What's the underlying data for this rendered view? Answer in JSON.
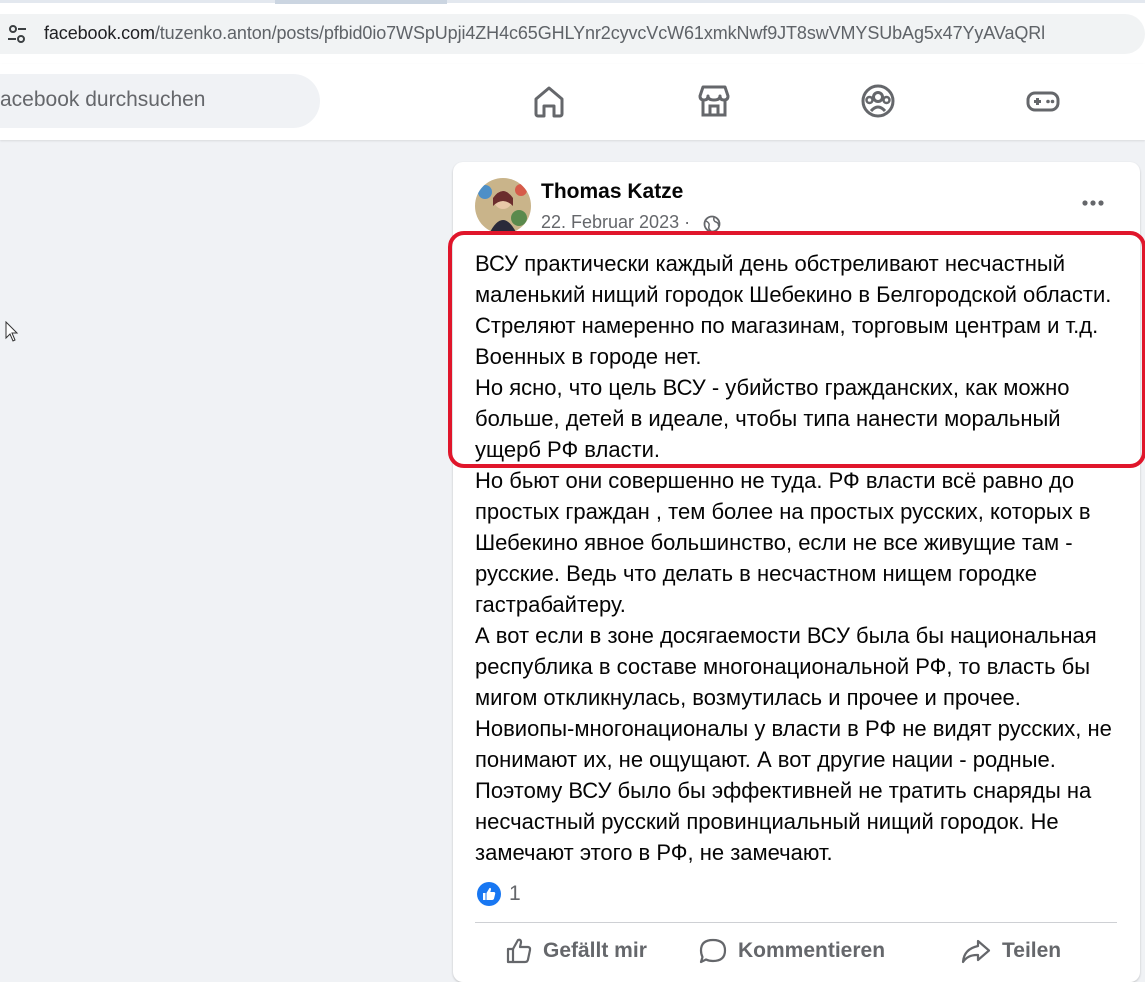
{
  "browser": {
    "url_host": "facebook.com",
    "url_path": "/tuzenko.anton/posts/pfbid0io7WSpUpji4ZH4c65GHLYnr2cyvcVcW61xmkNwf9JT8swVMYSUbAg5x47YyAVaQRl",
    "site_info_icon": "tune-icon"
  },
  "nav": {
    "search_placeholder": "acebook durchsuchen",
    "icons": [
      "home-icon",
      "marketplace-icon",
      "groups-icon",
      "gaming-icon"
    ]
  },
  "post": {
    "author": "Thomas Katze",
    "date": "22. Februar 2023 ·",
    "audience_icon": "globe-icon",
    "paragraphs_highlighted": [
      "ВСУ практически каждый день обстреливают несчастный маленький нищий городок Шебекино в Белгородской области. Стреляют намеренно по магазинам, торговым центрам и т.д. Военных в городе нет.",
      "Но ясно, что цель ВСУ - убийство гражданских, как можно больше, детей в идеале, чтобы типа нанести моральный ущерб РФ власти."
    ],
    "paragraphs_rest": [
      "Но бьют они совершенно не туда. РФ власти всё равно до простых граждан , тем более на простых русских, которых в Шебекино явное большинство, если не все живущие там - русские. Ведь что делать в несчастном нищем городке гастрабайтеру.",
      "А вот если в зоне досягаемости ВСУ была бы национальная республика в составе многонациональной РФ, то власть бы мигом откликнулась, возмутилась и прочее и прочее. Новиопы-многонационалы у власти в РФ не видят русских, не понимают их, не ощущают. А вот другие нации - родные. Поэтому ВСУ было бы эффективней не тратить снаряды на несчастный русский провинциальный нищий городок. Не замечают этого в РФ, не замечают."
    ],
    "reaction_count": "1",
    "actions": {
      "like": "Gefällt mir",
      "comment": "Kommentieren",
      "share": "Teilen"
    },
    "highlight_color": "#e0162b"
  },
  "colors": {
    "fb_blue": "#1877f2",
    "page_bg": "#f0f2f5",
    "secondary_text": "#65676b"
  }
}
